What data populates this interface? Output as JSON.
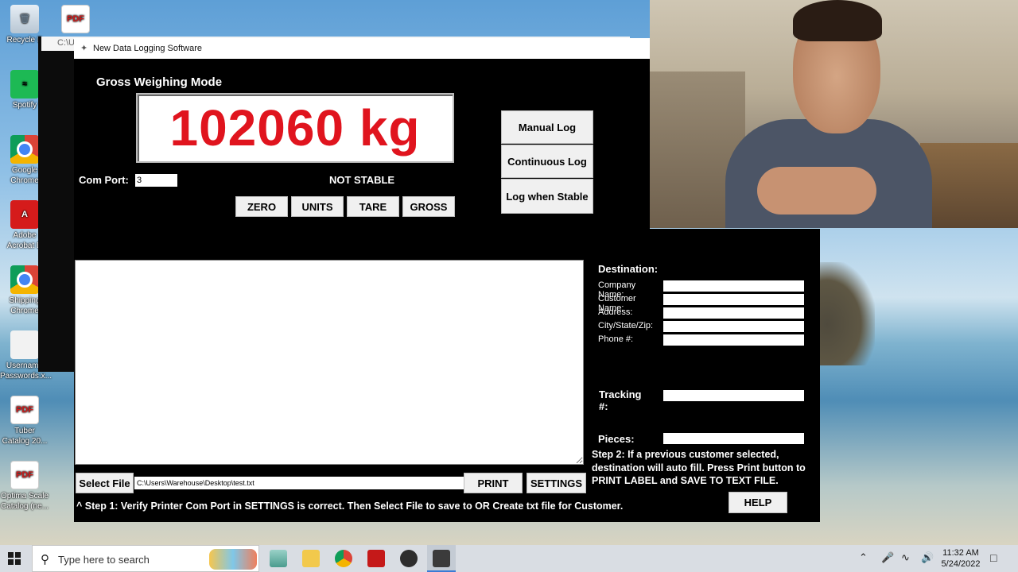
{
  "desktop": {
    "icons": [
      {
        "label": "Recycle B",
        "glyph": "bin"
      },
      {
        "label": "Spotify",
        "glyph": "spotify"
      },
      {
        "label": "Google Chrome",
        "glyph": "chrome"
      },
      {
        "label": "Adobe Acrobat D",
        "glyph": "acrobat"
      },
      {
        "label": "Shipping Chrome",
        "glyph": "chrome"
      },
      {
        "label": "Username Passwords.x...",
        "glyph": "file"
      },
      {
        "label": "Tuber Catalog 20...",
        "glyph": "pdf"
      },
      {
        "label": "Optima Scale Catalog (ne...",
        "glyph": "pdf"
      }
    ],
    "pdf_badge": "PDF",
    "background_tab": "C:\\U"
  },
  "app": {
    "title": "New Data Logging Software",
    "mode": "Gross Weighing Mode",
    "weight_display": "102060 kg",
    "com_port_label": "Com Port:",
    "com_port_value": "3",
    "stability": "NOT STABLE",
    "buttons": {
      "zero": "ZERO",
      "units": "UNITS",
      "tare": "TARE",
      "gross": "GROSS",
      "manual_log": "Manual Log",
      "continuous_log": "Continuous Log",
      "log_when_stable": "Log when Stable",
      "select_file": "Select File",
      "print": "PRINT",
      "settings": "SETTINGS",
      "help": "HELP"
    },
    "file_path": "C:\\Users\\Warehouse\\Desktop\\test.txt",
    "step1": "^ Step 1: Verify Printer Com Port in SETTINGS is correct. Then Select File to save to OR Create txt file for Customer.",
    "destination": {
      "title": "Destination:",
      "company_label": "Company Name:",
      "customer_label": "Customer Name:",
      "address_label": "Address:",
      "city_label": "City/State/Zip:",
      "phone_label": "Phone #:"
    },
    "tracking_label": "Tracking #:",
    "pieces_label": "Pieces:",
    "step2": "Step 2: If a previous customer selected, destination will auto fill. Press Print button to PRINT LABEL and SAVE TO TEXT FILE."
  },
  "taskbar": {
    "search_placeholder": "Type here to search",
    "time": "11:32 AM",
    "date": "5/24/2022"
  }
}
